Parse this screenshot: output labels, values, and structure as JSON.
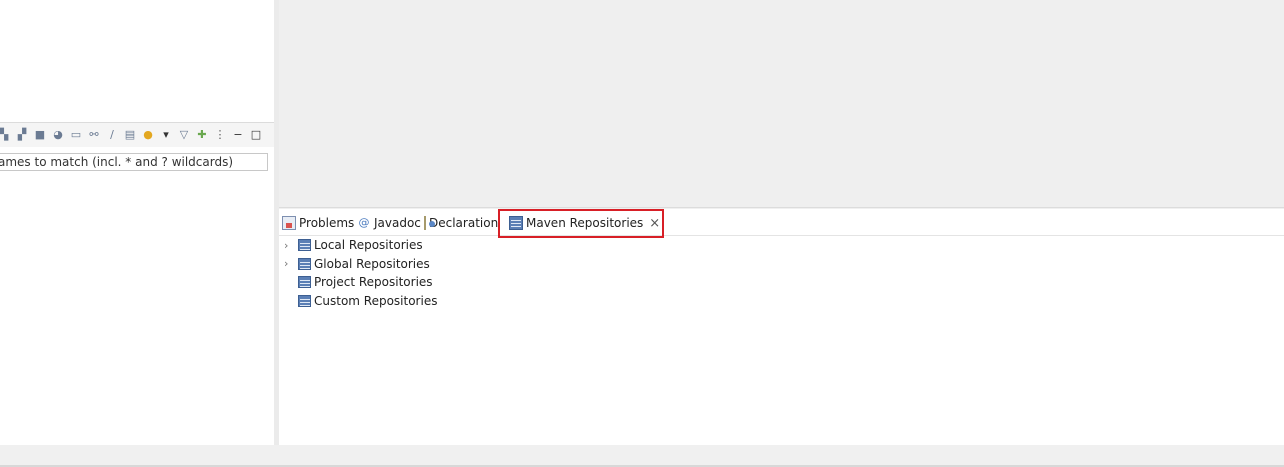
{
  "filter": {
    "placeholder": "ames to match (incl. * and ? wildcards)"
  },
  "toolbar": {
    "icons": [
      "collapse-icon",
      "expand-icon",
      "stop-icon",
      "chart-icon",
      "monitor-icon",
      "link-icon",
      "pencil-icon",
      "panel-icon",
      "lightbulb-icon",
      "dropdown-icon",
      "filter-icon",
      "add-icon",
      "more-icon",
      "minimize-icon",
      "maximize-icon"
    ]
  },
  "tabs": {
    "problems": "Problems",
    "javadoc": "Javadoc",
    "declaration": "Declaration",
    "maven": "Maven Repositories",
    "close": "×",
    "javadoc_glyph": "@"
  },
  "tree": [
    {
      "label": "Local Repositories",
      "expandable": true,
      "arrow": "›"
    },
    {
      "label": "Global Repositories",
      "expandable": true,
      "arrow": "›"
    },
    {
      "label": "Project Repositories",
      "expandable": false,
      "arrow": ""
    },
    {
      "label": "Custom Repositories",
      "expandable": false,
      "arrow": ""
    }
  ],
  "colors": {
    "highlight": "#d81f26",
    "background": "#f0f0f0"
  }
}
